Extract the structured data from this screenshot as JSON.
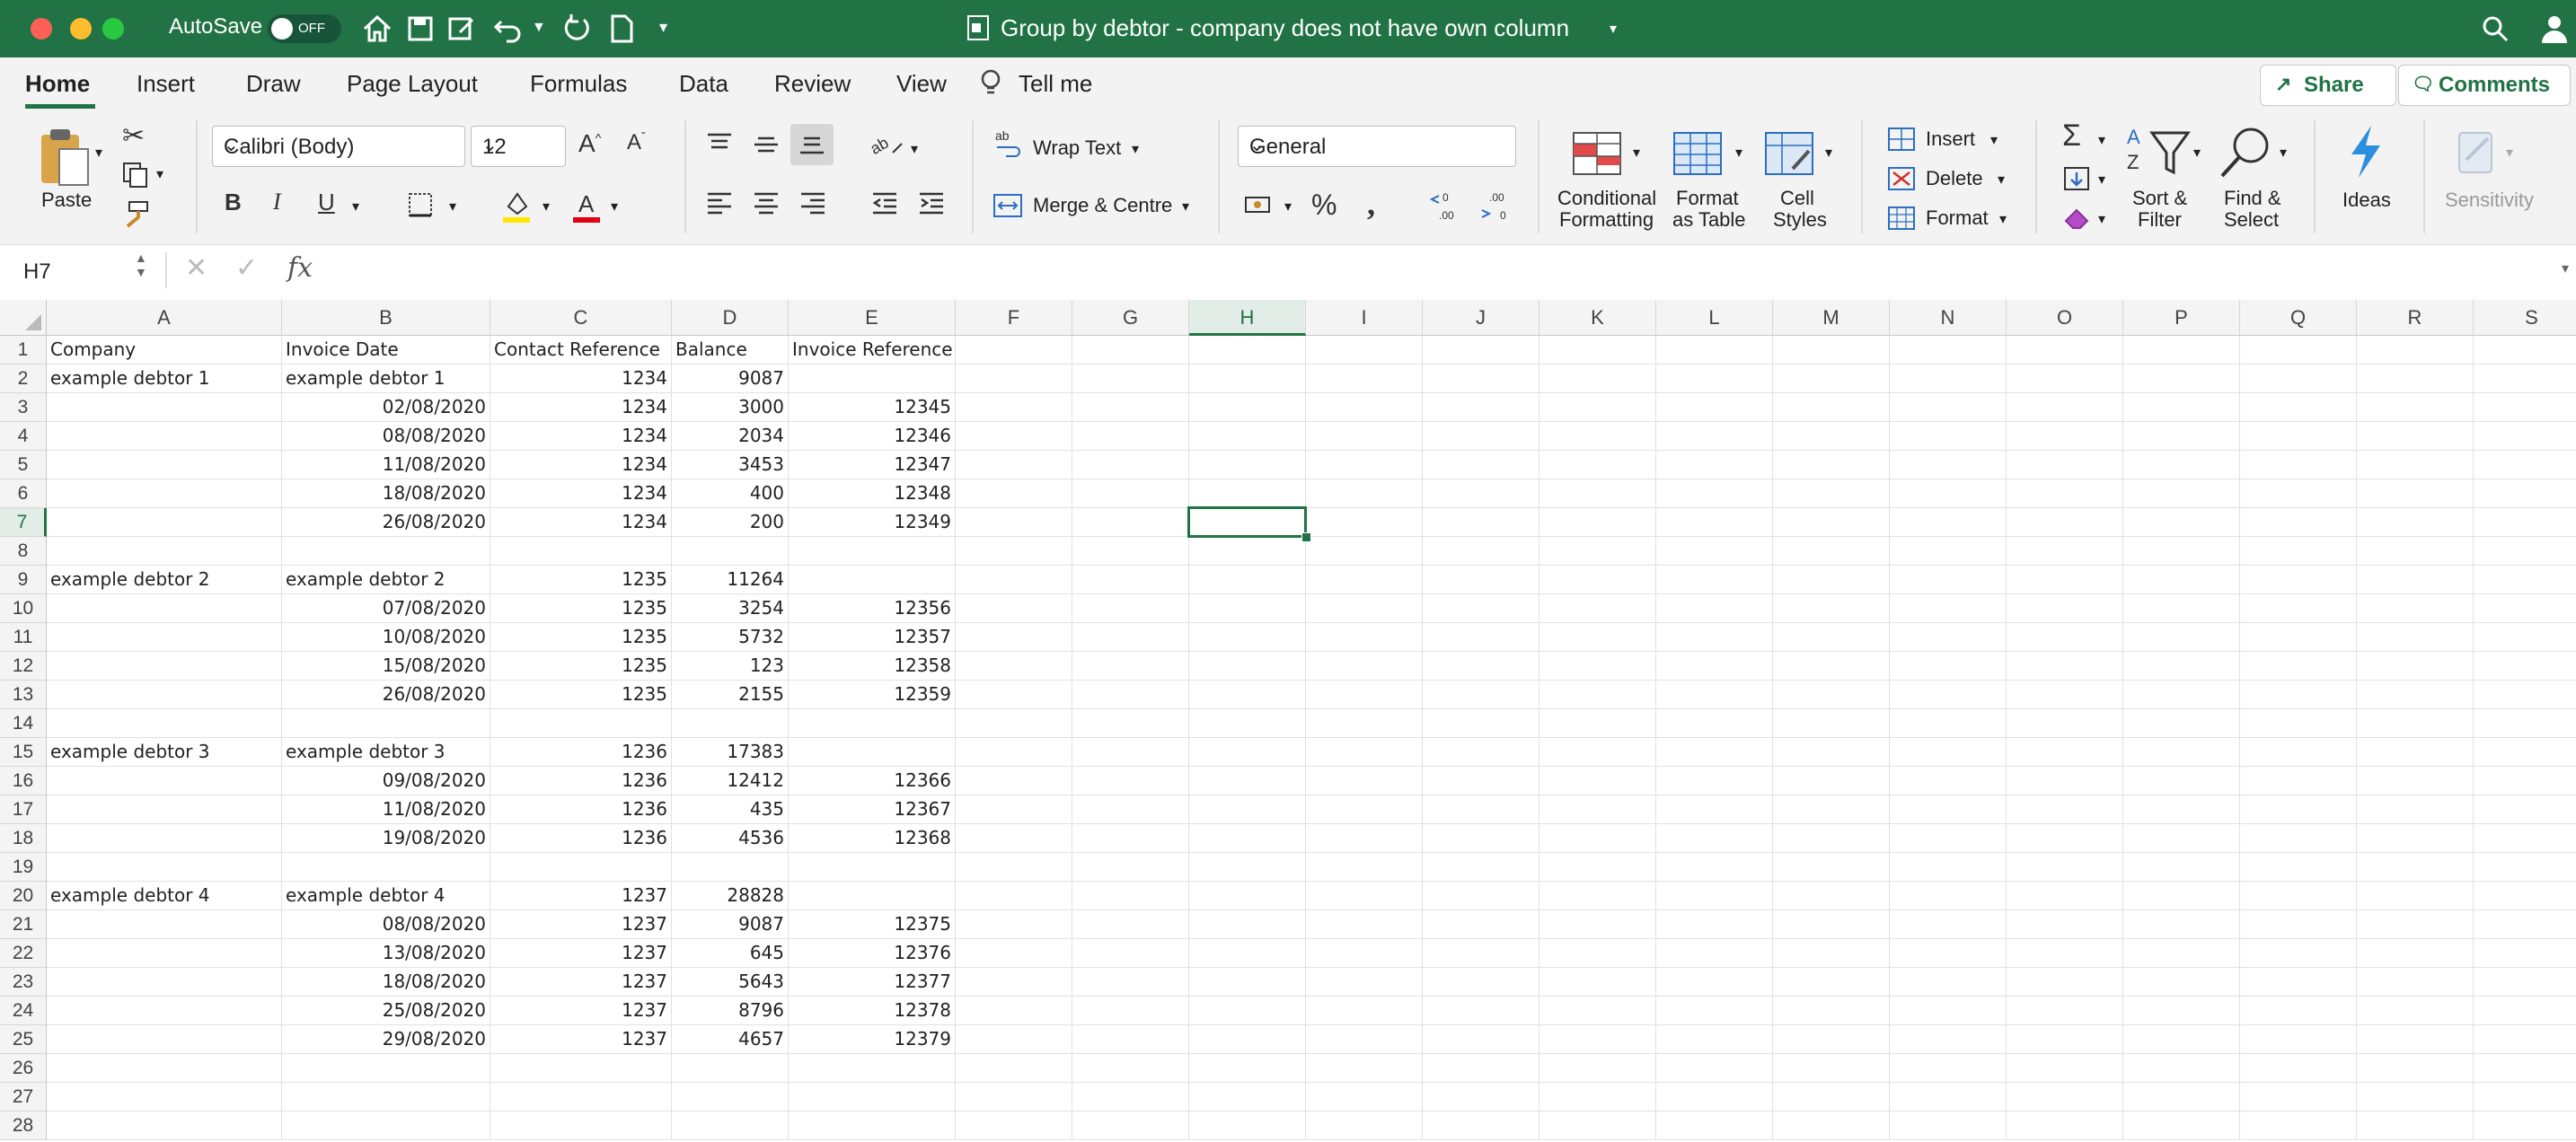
{
  "window": {
    "autosave_label": "AutoSave",
    "autosave_state": "OFF",
    "title": "Group by debtor - company does not have own column"
  },
  "ribbon_tabs": [
    "Home",
    "Insert",
    "Draw",
    "Page Layout",
    "Formulas",
    "Data",
    "Review",
    "View",
    "Tell me"
  ],
  "buttons": {
    "share": "Share",
    "comments": "Comments"
  },
  "ribbon": {
    "paste": "Paste",
    "font_name": "Calibri (Body)",
    "font_size": "12",
    "wrap_text": "Wrap Text",
    "merge_centre": "Merge & Centre",
    "number_format": "General",
    "conditional_formatting": [
      "Conditional",
      "Formatting"
    ],
    "format_as_table": [
      "Format",
      "as Table"
    ],
    "cell_styles": [
      "Cell",
      "Styles"
    ],
    "insert": "Insert",
    "delete": "Delete",
    "format": "Format",
    "sort_filter": [
      "Sort &",
      "Filter"
    ],
    "find_select": [
      "Find &",
      "Select"
    ],
    "ideas": "Ideas",
    "sensitivity": "Sensitivity"
  },
  "formula_bar": {
    "name_box": "H7",
    "formula": ""
  },
  "columns": [
    "A",
    "B",
    "C",
    "D",
    "E",
    "F",
    "G",
    "H",
    "I",
    "J",
    "K",
    "L",
    "M",
    "N",
    "O",
    "P",
    "Q",
    "R",
    "S"
  ],
  "selected_column": "H",
  "selected_row": 7,
  "row_numbers": [
    1,
    2,
    3,
    4,
    5,
    6,
    7,
    8,
    9,
    10,
    11,
    12,
    13,
    14,
    15,
    16,
    17,
    18,
    19,
    20,
    21,
    22,
    23,
    24,
    25,
    26,
    27,
    28
  ],
  "rows": [
    [
      "Company",
      "Invoice Date",
      "Contact Reference",
      "Balance",
      "Invoice Reference"
    ],
    [
      "example debtor 1",
      "example debtor 1",
      "1234",
      "9087",
      ""
    ],
    [
      "",
      "02/08/2020",
      "1234",
      "3000",
      "12345"
    ],
    [
      "",
      "08/08/2020",
      "1234",
      "2034",
      "12346"
    ],
    [
      "",
      "11/08/2020",
      "1234",
      "3453",
      "12347"
    ],
    [
      "",
      "18/08/2020",
      "1234",
      "400",
      "12348"
    ],
    [
      "",
      "26/08/2020",
      "1234",
      "200",
      "12349"
    ],
    [
      "",
      "",
      "",
      "",
      ""
    ],
    [
      "example debtor 2",
      "example debtor 2",
      "1235",
      "11264",
      ""
    ],
    [
      "",
      "07/08/2020",
      "1235",
      "3254",
      "12356"
    ],
    [
      "",
      "10/08/2020",
      "1235",
      "5732",
      "12357"
    ],
    [
      "",
      "15/08/2020",
      "1235",
      "123",
      "12358"
    ],
    [
      "",
      "26/08/2020",
      "1235",
      "2155",
      "12359"
    ],
    [
      "",
      "",
      "",
      "",
      ""
    ],
    [
      "example debtor 3",
      "example debtor 3",
      "1236",
      "17383",
      ""
    ],
    [
      "",
      "09/08/2020",
      "1236",
      "12412",
      "12366"
    ],
    [
      "",
      "11/08/2020",
      "1236",
      "435",
      "12367"
    ],
    [
      "",
      "19/08/2020",
      "1236",
      "4536",
      "12368"
    ],
    [
      "",
      "",
      "",
      "",
      ""
    ],
    [
      "example debtor 4",
      "example debtor 4",
      "1237",
      "28828",
      ""
    ],
    [
      "",
      "08/08/2020",
      "1237",
      "9087",
      "12375"
    ],
    [
      "",
      "13/08/2020",
      "1237",
      "645",
      "12376"
    ],
    [
      "",
      "18/08/2020",
      "1237",
      "5643",
      "12377"
    ],
    [
      "",
      "25/08/2020",
      "1237",
      "8796",
      "12378"
    ],
    [
      "",
      "29/08/2020",
      "1237",
      "4657",
      "12379"
    ],
    [
      "",
      "",
      "",
      "",
      ""
    ],
    [
      "",
      "",
      "",
      "",
      ""
    ],
    [
      "",
      "",
      "",
      "",
      ""
    ]
  ]
}
